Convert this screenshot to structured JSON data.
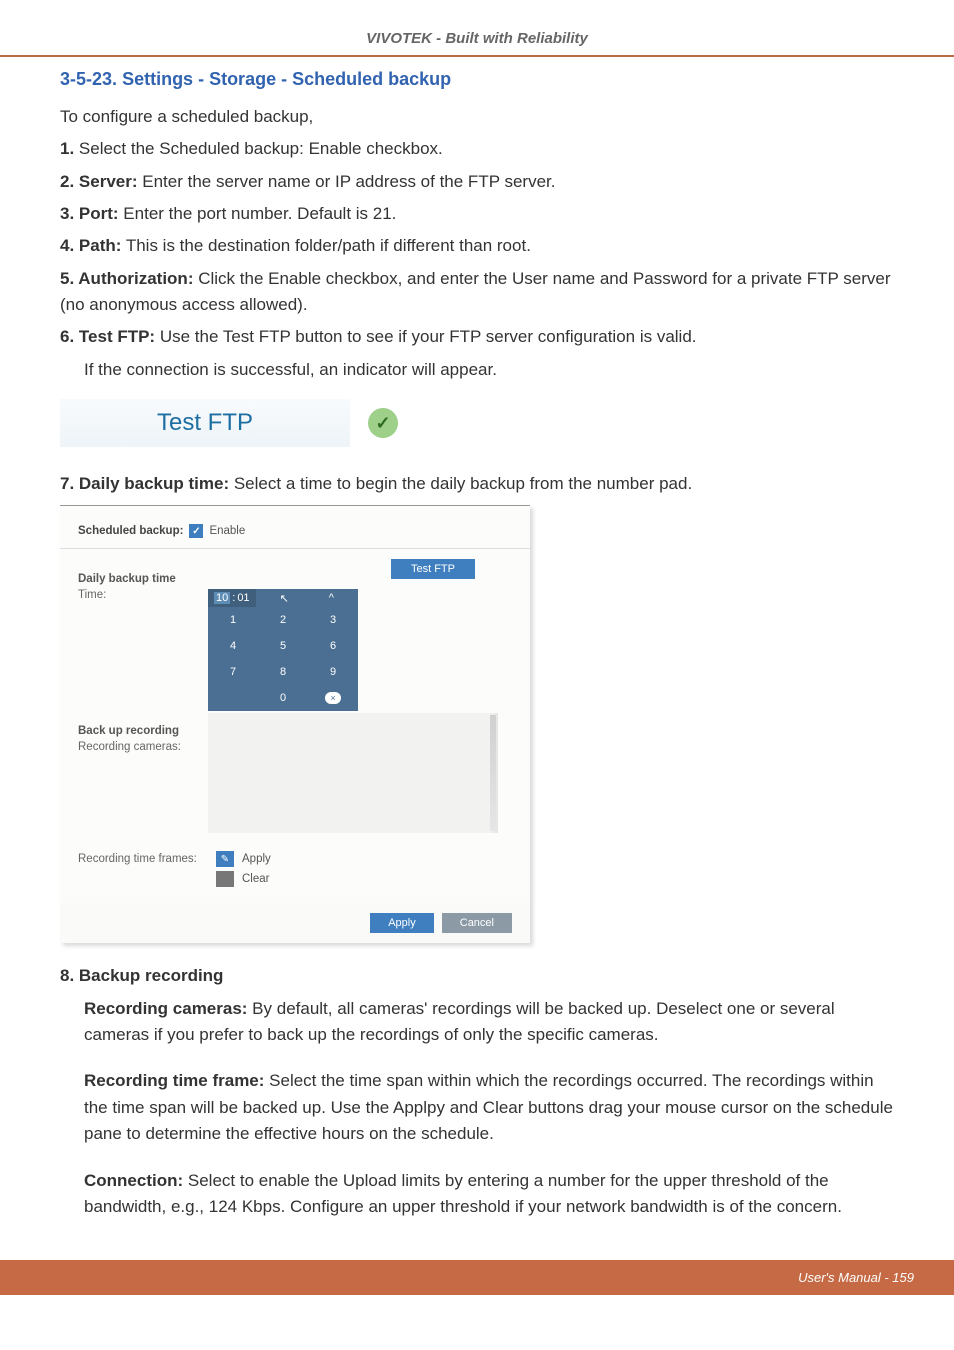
{
  "header": {
    "title": "VIVOTEK - Built with Reliability"
  },
  "section": {
    "number": "3-5-23.",
    "title": "Settings - Storage - Scheduled backup"
  },
  "intro": "To configure a scheduled backup,",
  "steps": {
    "s1": {
      "n": "1.",
      "text": " Select the Scheduled backup: Enable checkbox."
    },
    "s2": {
      "n": "2. ",
      "b": "Server:",
      "text": " Enter the server name or IP address of the FTP server."
    },
    "s3": {
      "n": "3. ",
      "b": "Port:",
      "text": " Enter the port number. Default is 21."
    },
    "s4": {
      "n": "4. ",
      "b": "Path:",
      "text": " This is the destination folder/path if different than root."
    },
    "s5": {
      "n": "5. ",
      "b": "Authorization:",
      "text": "  Click the Enable checkbox, and enter the User name and Password for a private FTP server (no anonymous access allowed)."
    },
    "s6": {
      "n": "6. ",
      "b": "Test FTP:",
      "text": " Use the Test FTP button to see if your FTP server configuration is valid."
    },
    "s6b": "If the connection is successful, an indicator will appear.",
    "s7": {
      "n": "7. ",
      "b": "Daily backup time:",
      "text": " Select a time to begin the daily backup from the number pad."
    },
    "s8": {
      "n": "8. ",
      "b": "Backup recording"
    },
    "s8a": {
      "b": "Recording cameras:",
      "text": " By default, all cameras' recordings will be backed up. Deselect one or several cameras if you prefer to back up the recordings of only the specific cameras."
    },
    "s8b": {
      "b": "Recording time frame:",
      "text": " Select the time span within which the recordings occurred. The recordings within the time span will be backed up. Use the Applpy and Clear buttons drag your mouse cursor on the schedule pane to determine the effective hours on the schedule."
    },
    "s8c": {
      "b": "Connection:",
      "text": " Select to enable the Upload limits by entering a number for the upper threshold of the bandwidth, e.g., 124 Kbps. Configure an upper threshold if your network bandwidth is of the concern."
    }
  },
  "testftp_button": "Test FTP",
  "panel": {
    "scheduled_backup_label": "Scheduled backup:",
    "enable_label": "Enable",
    "testftp_small": "Test FTP",
    "daily_backup_time": "Daily backup time",
    "time_label": "Time:",
    "time_value_hh": "10",
    "time_value_mm": "01",
    "back_up_recording": "Back up recording",
    "recording_cameras": "Recording cameras:",
    "recording_time_frames": "Recording time frames:",
    "apply_label": "Apply",
    "clear_label": "Clear",
    "btn_apply": "Apply",
    "btn_cancel": "Cancel",
    "numpad": {
      "cells": [
        "1",
        "2",
        "3",
        "4",
        "5",
        "6",
        "7",
        "8",
        "9",
        "",
        "0",
        "⌫"
      ],
      "caret": "^"
    }
  },
  "footer": {
    "text": "User's Manual - 159"
  }
}
